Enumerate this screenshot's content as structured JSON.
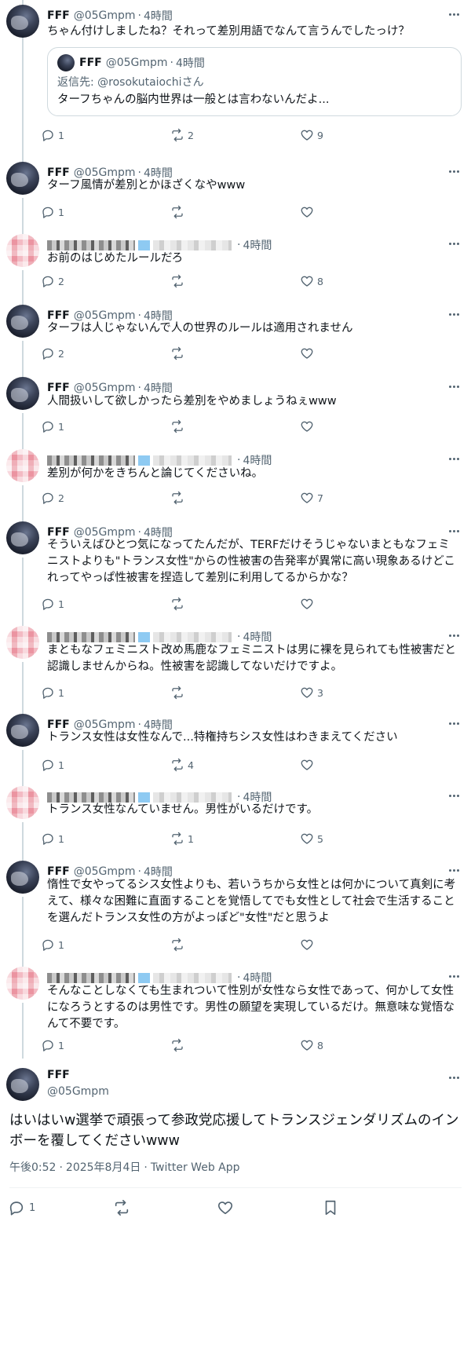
{
  "tweets": [
    {
      "author_name": "FFF",
      "handle": "@05Gmpm",
      "time": "4時間",
      "avatar": "fff",
      "redacted": true,
      "text": "ちゃん付けしましたね？それって差別用語でなんて言うんでしたっけ？",
      "quote": {
        "name": "FFF",
        "handle": "@05Gmpm",
        "time": "4時間",
        "reply_to": "返信先: @rosokutaiochiさん",
        "text": "ターフちゃんの脳内世界は一般とは言わないんだよ..."
      },
      "replies": "1",
      "retweets": "2",
      "likes": "9"
    },
    {
      "author_name": "FFF",
      "handle": "@05Gmpm",
      "time": "4時間",
      "avatar": "fff",
      "redacted": false,
      "text": "ターフ風情が差別とかほざくなやwww",
      "replies": "1",
      "retweets": "",
      "likes": ""
    },
    {
      "author_name": "",
      "handle": "",
      "time": "4時間",
      "avatar": "blur",
      "redacted": true,
      "text": "お前のはじめたルールだろ",
      "replies": "2",
      "retweets": "",
      "likes": "8"
    },
    {
      "author_name": "FFF",
      "handle": "@05Gmpm",
      "time": "4時間",
      "avatar": "fff",
      "redacted": false,
      "text": "ターフは人じゃないんで人の世界のルールは適用されません",
      "replies": "2",
      "retweets": "",
      "likes": ""
    },
    {
      "author_name": "FFF",
      "handle": "@05Gmpm",
      "time": "4時間",
      "avatar": "fff",
      "redacted": false,
      "text": "人間扱いして欲しかったら差別をやめましょうねぇwww",
      "replies": "1",
      "retweets": "",
      "likes": ""
    },
    {
      "author_name": "",
      "handle": "",
      "time": "4時間",
      "avatar": "blur",
      "redacted": true,
      "text": "差別が何かをきちんと論じてくださいね。",
      "replies": "2",
      "retweets": "",
      "likes": "7"
    },
    {
      "author_name": "FFF",
      "handle": "@05Gmpm",
      "time": "4時間",
      "avatar": "fff",
      "redacted": false,
      "text": "そういえばひとつ気になってたんだが、TERFだけそうじゃないまともなフェミニストよりも\"トランス女性\"からの性被害の告発率が異常に高い現象あるけどこれってやっぱ性被害を捏造して差別に利用してるからかな？",
      "replies": "1",
      "retweets": "",
      "likes": ""
    },
    {
      "author_name": "",
      "handle": "",
      "time": "4時間",
      "avatar": "blur",
      "redacted": true,
      "text": "まともなフェミニスト改め馬鹿なフェミニストは男に裸を見られても性被害だと認識しませんからね。性被害を認識してないだけですよ。",
      "replies": "1",
      "retweets": "",
      "likes": "3"
    },
    {
      "author_name": "FFF",
      "handle": "@05Gmpm",
      "time": "4時間",
      "avatar": "fff",
      "redacted": false,
      "text": "トランス女性は女性なんで...特権持ちシス女性はわきまえてください",
      "replies": "1",
      "retweets": "4",
      "likes": ""
    },
    {
      "author_name": "",
      "handle": "",
      "time": "4時間",
      "avatar": "blur",
      "redacted": true,
      "text": "トランス女性なんていません。男性がいるだけです。",
      "replies": "1",
      "retweets": "1",
      "likes": "5"
    },
    {
      "author_name": "FFF",
      "handle": "@05Gmpm",
      "time": "4時間",
      "avatar": "fff",
      "redacted": false,
      "text": "惰性で女やってるシス女性よりも、若いうちから女性とは何かについて真剣に考えて、様々な困難に直面することを覚悟してでも女性として社会で生活することを選んだトランス女性の方がよっぽど\"女性\"だと思うよ",
      "replies": "1",
      "retweets": "",
      "likes": ""
    },
    {
      "author_name": "",
      "handle": "",
      "time": "4時間",
      "avatar": "blur",
      "redacted": true,
      "text": "そんなことしなくても生まれついて性別が女性なら女性であって、何かして女性になろうとするのは男性です。男性の願望を実現しているだけ。無意味な覚悟なんて不要です。",
      "replies": "1",
      "retweets": "",
      "likes": "8"
    }
  ],
  "main": {
    "name": "FFF",
    "handle": "@05Gmpm",
    "text": "はいはいw選挙で頑張って参政党応援してトランスジェンダリズムのインボーを覆してくださいwww",
    "time": "午後0:52",
    "date": "2025年8月4日",
    "source": "Twitter Web App",
    "replies": "1"
  },
  "icons": {
    "reply": "reply-icon",
    "retweet": "retweet-icon",
    "like": "heart-icon",
    "bookmark": "bookmark-icon",
    "more": "more-icon"
  }
}
